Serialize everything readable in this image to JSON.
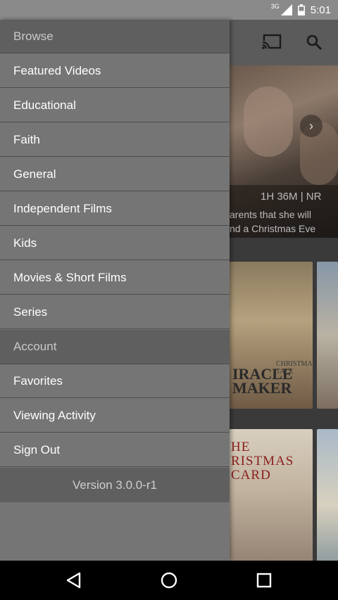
{
  "status_bar": {
    "network_label": "3G",
    "time": "5:01"
  },
  "app": {
    "hero": {
      "meta": "1H 36M  |  NR",
      "description_line1": "arents that she will",
      "description_line2": "nd a Christmas Eve"
    },
    "poster_1": {
      "title": "IRACLE\nMAKER",
      "tagline": "CHRISTMAS\nTALE"
    },
    "poster_3": {
      "title": "HE\nRISTMAS\nCARD"
    }
  },
  "drawer": {
    "browse_header": "Browse",
    "browse_items": [
      {
        "label": "Featured Videos"
      },
      {
        "label": "Educational"
      },
      {
        "label": "Faith"
      },
      {
        "label": "General"
      },
      {
        "label": "Independent Films"
      },
      {
        "label": "Kids"
      },
      {
        "label": "Movies & Short Films"
      },
      {
        "label": "Series"
      }
    ],
    "account_header": "Account",
    "account_items": [
      {
        "label": "Favorites"
      },
      {
        "label": "Viewing Activity"
      },
      {
        "label": "Sign Out"
      }
    ],
    "version": "Version 3.0.0-r1"
  },
  "icons": {
    "cast": "cast-icon",
    "search": "search-icon",
    "back": "back-icon",
    "home": "home-icon",
    "recents": "recents-icon"
  }
}
